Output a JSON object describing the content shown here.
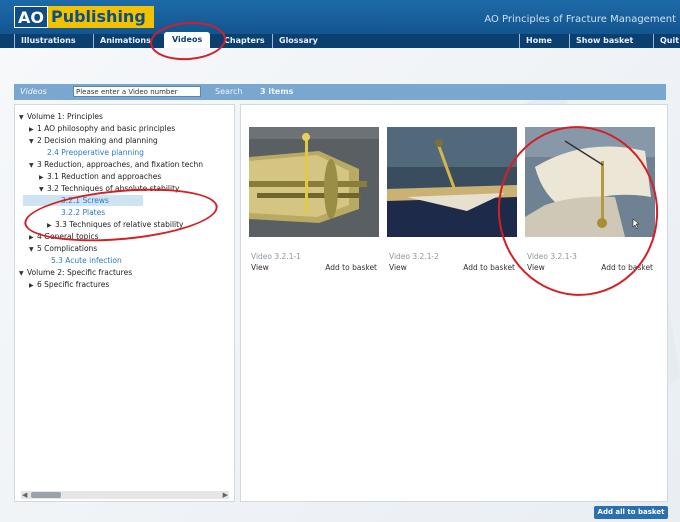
{
  "app": {
    "logo_left": "AO",
    "logo_right": "Publishing",
    "title": "AO Principles of Fracture Management"
  },
  "nav": {
    "items": [
      "Illustrations",
      "Animations",
      "Videos",
      "Chapters",
      "Glossary",
      "Home",
      "Show basket",
      "Quit"
    ],
    "active": "Videos"
  },
  "search": {
    "label": "Videos",
    "placeholder": "Please enter a Video number",
    "button": "Search",
    "count": "3 items"
  },
  "tree": [
    {
      "text": "Volume 1: Principles",
      "icon": "triangle-down"
    },
    {
      "text": "1 AO philosophy and basic principles",
      "icon": "triangle-right"
    },
    {
      "text": "2 Decision making and planning",
      "icon": "triangle-down"
    },
    {
      "text": "2.4 Preoperative planning",
      "icon": ""
    },
    {
      "text": "3 Reduction, approaches, and fixation techn",
      "icon": "triangle-down"
    },
    {
      "text": "3.1 Reduction and approaches",
      "icon": "triangle-right"
    },
    {
      "text": "3.2 Techniques of absolute stability",
      "icon": "triangle-down"
    },
    {
      "text": "3.2.1 Screws",
      "icon": ""
    },
    {
      "text": "3.2.2 Plates",
      "icon": ""
    },
    {
      "text": "3.3 Techniques of relative stability",
      "icon": "triangle-right"
    },
    {
      "text": "4 General topics",
      "icon": "triangle-right"
    },
    {
      "text": "5 Complications",
      "icon": "triangle-down"
    },
    {
      "text": "5.3 Acute infection",
      "icon": ""
    },
    {
      "text": "Volume 2: Specific fractures",
      "icon": "triangle-down"
    },
    {
      "text": "6 Specific fractures",
      "icon": "triangle-right"
    }
  ],
  "videos": [
    {
      "caption": "Video 3.2.1-1",
      "view": "View",
      "add": "Add to basket"
    },
    {
      "caption": "Video 3.2.1-2",
      "view": "View",
      "add": "Add to basket"
    },
    {
      "caption": "Video 3.2.1-3",
      "view": "View",
      "add": "Add to basket"
    }
  ],
  "footer": {
    "add_all": "Add all to basket"
  },
  "colors": {
    "header": "#0e4d86",
    "logo_accent": "#f2c200",
    "link": "#2a7bbf",
    "annotation": "#d32027"
  }
}
